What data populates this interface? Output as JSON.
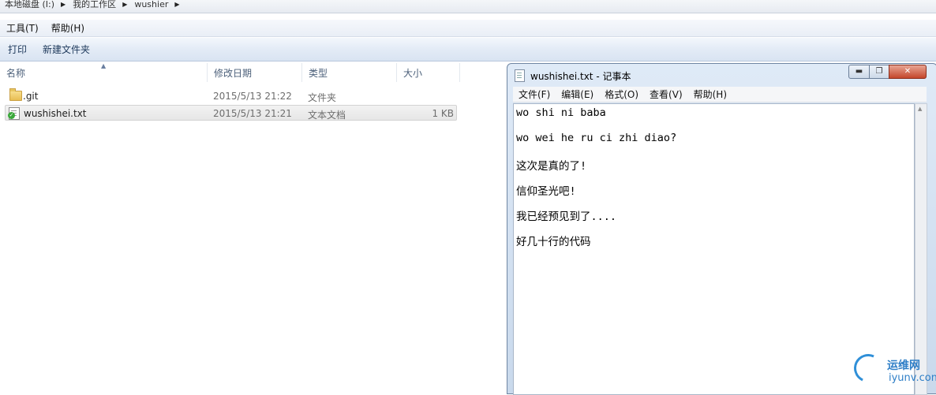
{
  "explorer": {
    "breadcrumb": [
      "本地磁盘 (I:)",
      "我的工作区",
      "wushier"
    ],
    "menu": [
      "工具(T)",
      "帮助(H)"
    ],
    "toolbar": [
      "打印",
      "新建文件夹"
    ],
    "columns": {
      "name": "名称",
      "date": "修改日期",
      "type": "类型",
      "size": "大小"
    },
    "files": [
      {
        "name": ".git",
        "date": "2015/5/13 21:22",
        "type": "文件夹",
        "size": "",
        "icon": "folder-icon",
        "selected": false
      },
      {
        "name": "wushishei.txt",
        "date": "2015/5/13 21:21",
        "type": "文本文档",
        "size": "1 KB",
        "icon": "text-file-icon",
        "selected": true
      }
    ]
  },
  "notepad": {
    "title": "wushishei.txt - 记事本",
    "menu": [
      "文件(F)",
      "编辑(E)",
      "格式(O)",
      "查看(V)",
      "帮助(H)"
    ],
    "lines": [
      "wo shi ni baba",
      "wo wei he ru ci zhi diao?",
      "这次是真的了!",
      "信仰圣光吧!",
      "我已经预见到了....",
      "好几十行的代码"
    ]
  },
  "watermark": {
    "brand": "运维网",
    "domain": "iyunv.com"
  }
}
